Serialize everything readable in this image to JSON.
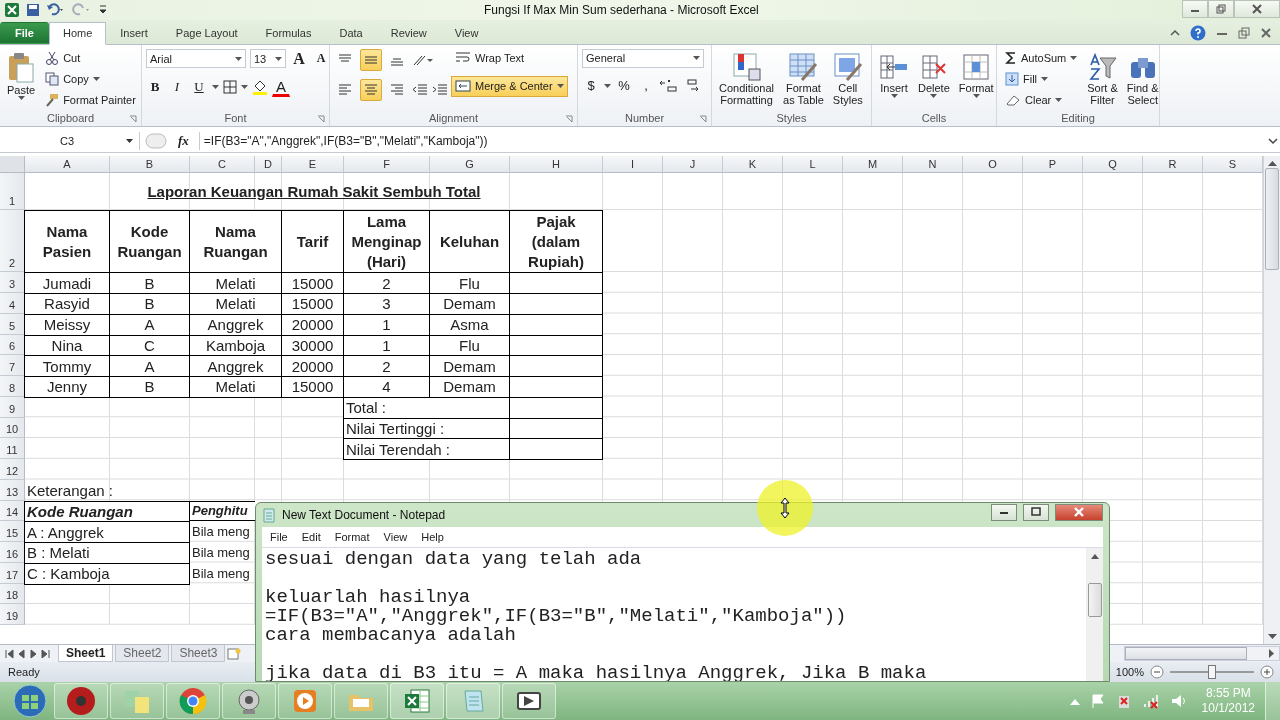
{
  "title_bar": {
    "title": "Fungsi If Max Min Sum sederhana  -  Microsoft Excel"
  },
  "ribbon_tabs": [
    {
      "label": "File",
      "kind": "file",
      "selected": false
    },
    {
      "label": "Home",
      "kind": "tab",
      "selected": true
    },
    {
      "label": "Insert",
      "kind": "tab",
      "selected": false
    },
    {
      "label": "Page Layout",
      "kind": "tab",
      "selected": false
    },
    {
      "label": "Formulas",
      "kind": "tab",
      "selected": false
    },
    {
      "label": "Data",
      "kind": "tab",
      "selected": false
    },
    {
      "label": "Review",
      "kind": "tab",
      "selected": false
    },
    {
      "label": "View",
      "kind": "tab",
      "selected": false
    }
  ],
  "clipboard": {
    "label": "Clipboard",
    "paste": "Paste",
    "cut": "Cut",
    "copy": "Copy",
    "format_painter": "Format Painter"
  },
  "font": {
    "label": "Font",
    "family": "Arial",
    "size": "13",
    "grow": "A",
    "shrink": "A",
    "bold": "B",
    "italic": "I",
    "underline": "U",
    "color_letter": "A"
  },
  "alignment": {
    "label": "Alignment",
    "wrap_text": "Wrap Text",
    "merge": {
      "label": "Merge & Center",
      "selected": true
    },
    "vertical": [
      {
        "kind": "top",
        "selected": false
      },
      {
        "kind": "middle",
        "selected": true
      },
      {
        "kind": "bottom",
        "selected": false
      }
    ],
    "horizontal": [
      {
        "kind": "left",
        "selected": false
      },
      {
        "kind": "center",
        "selected": true
      },
      {
        "kind": "right",
        "selected": false
      }
    ]
  },
  "number": {
    "label": "Number",
    "format": "General",
    "currency": "$",
    "percent": "%",
    "comma": ","
  },
  "styles": {
    "label": "Styles",
    "items": [
      {
        "kind": "conditional",
        "lines": [
          "Conditional",
          "Formatting"
        ]
      },
      {
        "kind": "table",
        "lines": [
          "Format",
          "as Table"
        ]
      },
      {
        "kind": "cell",
        "lines": [
          "Cell",
          "Styles"
        ]
      }
    ]
  },
  "cells": {
    "label": "Cells",
    "items": [
      {
        "kind": "insert",
        "label": "Insert"
      },
      {
        "kind": "delete",
        "label": "Delete"
      },
      {
        "kind": "format",
        "label": "Format"
      }
    ]
  },
  "editing": {
    "label": "Editing",
    "autosum": "AutoSum",
    "fill": "Fill",
    "clear": "Clear",
    "sort": [
      "Sort &",
      "Filter"
    ],
    "find": [
      "Find &",
      "Select"
    ]
  },
  "formula_bar": {
    "name_box": "C3",
    "fx": "fx",
    "formula": "=IF(B3=\"A\",\"Anggrek\",IF(B3=\"B\",\"Melati\",\"Kamboja\"))"
  },
  "columns": [
    "A",
    "B",
    "C",
    "D",
    "E",
    "F",
    "G",
    "H",
    "I",
    "J",
    "K",
    "L",
    "M",
    "N",
    "O",
    "P",
    "Q",
    "R",
    "S"
  ],
  "rows": [
    "1",
    "2",
    "3",
    "4",
    "5",
    "6",
    "7",
    "8",
    "9",
    "10",
    "11",
    "12",
    "13",
    "14",
    "15",
    "16",
    "17",
    "18",
    "19"
  ],
  "report": {
    "title": "Laporan Keuangan Rumah Sakit Sembuh Total",
    "headers": [
      "Nama\nPasien",
      "Kode\nRuangan",
      "Nama\nRuangan",
      "Tarif",
      "Lama\nMenginap\n(Hari)",
      "Keluhan",
      "Pajak\n(dalam\nRupiah)"
    ],
    "entries": [
      {
        "nama": "Jumadi",
        "kode": "B",
        "ruangan": "Melati",
        "tarif": "15000",
        "lama": "2",
        "keluhan": "Flu"
      },
      {
        "nama": "Rasyid",
        "kode": "B",
        "ruangan": "Melati",
        "tarif": "15000",
        "lama": "3",
        "keluhan": "Demam"
      },
      {
        "nama": "Meissy",
        "kode": "A",
        "ruangan": "Anggrek",
        "tarif": "20000",
        "lama": "1",
        "keluhan": "Asma"
      },
      {
        "nama": "Nina",
        "kode": "C",
        "ruangan": "Kamboja",
        "tarif": "30000",
        "lama": "1",
        "keluhan": "Flu"
      },
      {
        "nama": "Tommy",
        "kode": "A",
        "ruangan": "Anggrek",
        "tarif": "20000",
        "lama": "2",
        "keluhan": "Demam"
      },
      {
        "nama": "Jenny",
        "kode": "B",
        "ruangan": "Melati",
        "tarif": "15000",
        "lama": "4",
        "keluhan": "Demam"
      }
    ],
    "summary": [
      "Total :",
      "Nilai Tertinggi :",
      "Nilai Terendah :"
    ]
  },
  "notes": {
    "heading": "Keterangan :",
    "columns": [
      "Kode Ruangan",
      "Penghitu"
    ],
    "rows": [
      {
        "code": "A : Anggrek",
        "note": "Bila meng"
      },
      {
        "code": "B : Melati",
        "note": "Bila meng"
      },
      {
        "code": "C : Kamboja",
        "note": "Bila meng"
      }
    ]
  },
  "sheet_tabs": [
    {
      "label": "Sheet1",
      "selected": true
    },
    {
      "label": "Sheet2",
      "selected": false
    },
    {
      "label": "Sheet3",
      "selected": false
    }
  ],
  "status_bar": {
    "status": "Ready",
    "zoom": "100%",
    "zoom_slider": {
      "level": 0.5
    }
  },
  "notepad": {
    "title": "New Text Document - Notepad",
    "menu": [
      "File",
      "Edit",
      "Format",
      "View",
      "Help"
    ],
    "paragraphs": [
      [
        "sesuai dengan data yang telah ada"
      ],
      [
        "keluarlah hasilnya",
        "=IF(B3=\"A\",\"Anggrek\",IF(B3=\"B\",\"Melati\",\"Kamboja\"))",
        "cara membacanya adalah"
      ],
      [
        "jika data di B3 itu = A maka hasilnya Anggrek, Jika B maka"
      ]
    ]
  },
  "taskbar": {
    "time": "8:55 PM",
    "date": "10/1/2012"
  }
}
